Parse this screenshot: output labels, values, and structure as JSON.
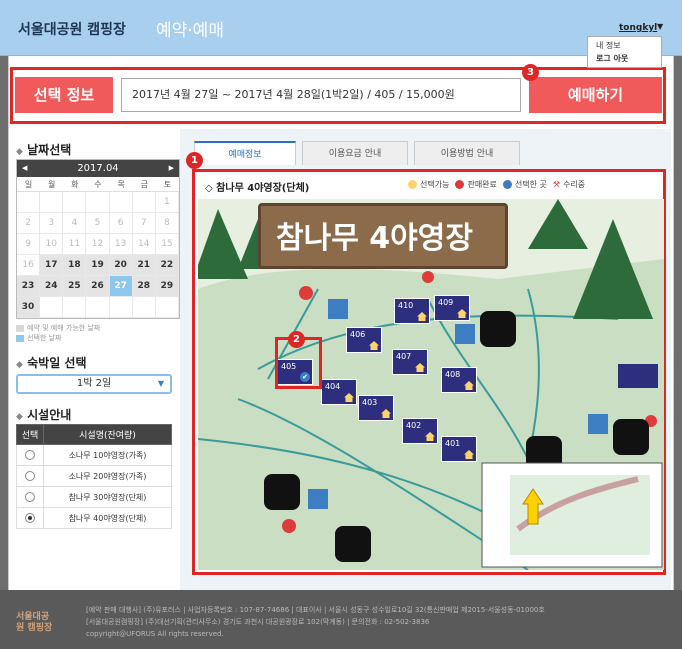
{
  "header": {
    "site_title": "서울대공원 캠핑장",
    "menu_title": "예약·예매",
    "user_name": "tongkyl",
    "user_menu": [
      "내 정보",
      "로그 아웃"
    ]
  },
  "selection": {
    "label": "선택 정보",
    "value": "2017년 4월 27일 ~ 2017년 4월 28일(1박2일) / 405 / 15,000원",
    "reserve_label": "예매하기"
  },
  "badges": [
    "1",
    "2",
    "3"
  ],
  "date_section": {
    "title": "날짜선택",
    "month": "2017.04",
    "weekdays": [
      "일",
      "월",
      "화",
      "수",
      "목",
      "금",
      "토"
    ],
    "days": [
      {
        "d": "",
        "s": "empty"
      },
      {
        "d": "",
        "s": "empty"
      },
      {
        "d": "",
        "s": "empty"
      },
      {
        "d": "",
        "s": "empty"
      },
      {
        "d": "",
        "s": "empty"
      },
      {
        "d": "",
        "s": "empty"
      },
      {
        "d": "1",
        "s": "off"
      },
      {
        "d": "2",
        "s": "off"
      },
      {
        "d": "3",
        "s": "off"
      },
      {
        "d": "4",
        "s": "off"
      },
      {
        "d": "5",
        "s": "off"
      },
      {
        "d": "6",
        "s": "off"
      },
      {
        "d": "7",
        "s": "off"
      },
      {
        "d": "8",
        "s": "off"
      },
      {
        "d": "9",
        "s": "off"
      },
      {
        "d": "10",
        "s": "off"
      },
      {
        "d": "11",
        "s": "off"
      },
      {
        "d": "12",
        "s": "off"
      },
      {
        "d": "13",
        "s": "off"
      },
      {
        "d": "14",
        "s": "off"
      },
      {
        "d": "15",
        "s": "off"
      },
      {
        "d": "16",
        "s": "off"
      },
      {
        "d": "17",
        "s": "avail"
      },
      {
        "d": "18",
        "s": "avail"
      },
      {
        "d": "19",
        "s": "avail"
      },
      {
        "d": "20",
        "s": "avail"
      },
      {
        "d": "21",
        "s": "avail"
      },
      {
        "d": "22",
        "s": "avail"
      },
      {
        "d": "23",
        "s": "avail"
      },
      {
        "d": "24",
        "s": "avail"
      },
      {
        "d": "25",
        "s": "avail"
      },
      {
        "d": "26",
        "s": "avail"
      },
      {
        "d": "27",
        "s": "sel"
      },
      {
        "d": "28",
        "s": "avail"
      },
      {
        "d": "29",
        "s": "avail"
      },
      {
        "d": "30",
        "s": "avail"
      },
      {
        "d": "",
        "s": "empty"
      },
      {
        "d": "",
        "s": "empty"
      },
      {
        "d": "",
        "s": "empty"
      },
      {
        "d": "",
        "s": "empty"
      },
      {
        "d": "",
        "s": "empty"
      },
      {
        "d": "",
        "s": "empty"
      }
    ],
    "legend_available": "예약 및 예매 가능한 날짜",
    "legend_selected": "선택한 날짜",
    "color_available": "#d8d8d8",
    "color_selected": "#8ec6ec"
  },
  "nights_section": {
    "title": "숙박일 선택",
    "selected": "1박 2일"
  },
  "facility_section": {
    "title": "시설안내",
    "col_select": "선택",
    "col_name": "시설명(잔여량)",
    "rows": [
      {
        "name": "소나무 10야영장(가족)",
        "checked": false
      },
      {
        "name": "소나무 20야영장(가족)",
        "checked": false
      },
      {
        "name": "참나무 30야영장(단체)",
        "checked": false
      },
      {
        "name": "참나무 40야영장(단체)",
        "checked": true
      }
    ]
  },
  "tabs": [
    "예매정보",
    "이용요금 안내",
    "이용방법 안내"
  ],
  "map": {
    "title": "참나무 4야영장(단체)",
    "legend": [
      "선택가능",
      "판매완료",
      "선택한 곳",
      "수리중"
    ],
    "banner": "참나무 4야영장",
    "sites": [
      "405",
      "404",
      "403",
      "402",
      "401",
      "406",
      "407",
      "408",
      "410",
      "409"
    ]
  },
  "footer": {
    "logo": "서울대공원 캠핑장",
    "line1": "[예약 판매 대행사] (주)유포러스 | 사업자등록번호 : 107-87-74686 | 대표이사 | 서울시 성동구 성수일로10길 32(통신판매업 제2015-서울성동-01000호",
    "line2": "[서울대공원캠핑장] (주)대선기획(관리사무소) 경기도 과천시 대공원광장로 102(막계동) | 문의전화 : 02-502-3836",
    "line3": "copyright@UFORUS All rights reserved."
  }
}
